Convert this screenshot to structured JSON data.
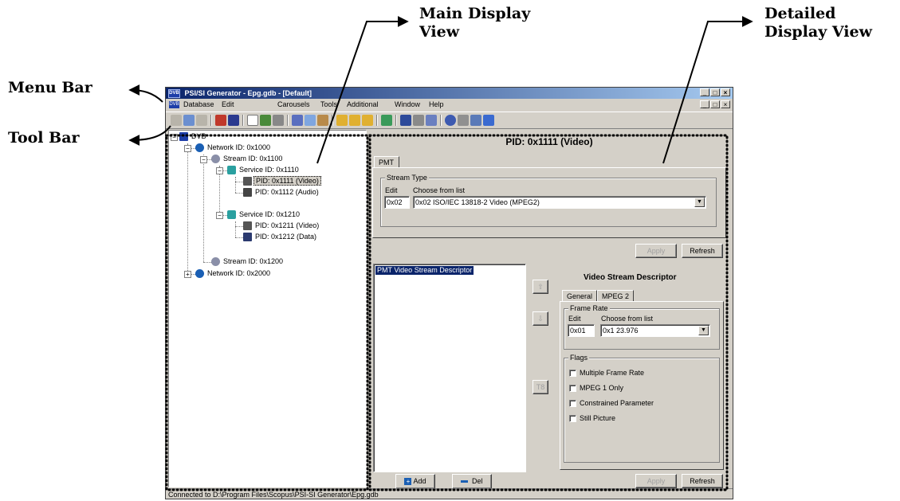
{
  "callouts": {
    "main_display_view": [
      "Main Display",
      "View"
    ],
    "detailed_display_view": [
      "Detailed",
      "Display View"
    ],
    "menu_bar": "Menu Bar",
    "tool_bar": "Tool Bar"
  },
  "window": {
    "app_icon": "DVB",
    "title": "PSI/SI Generator - Epg.gdb - [Default]",
    "buttons": [
      "_",
      "□",
      "×"
    ]
  },
  "menu": {
    "doc_icon": "DVB",
    "items": [
      "Database",
      "Edit",
      "Carousels",
      "Tools",
      "Additional",
      "Window",
      "Help"
    ]
  },
  "tree": {
    "nodes": [
      {
        "label": "DVB",
        "icon": "dvb-icon",
        "selected": false
      },
      {
        "label": "Network ID: 0x1000",
        "icon": "globe-icon",
        "selected": false
      },
      {
        "label": "Stream ID: 0x1100",
        "icon": "satellite-dish-icon",
        "selected": false
      },
      {
        "label": "Service ID: 0x1110",
        "icon": "service-icon",
        "selected": false
      },
      {
        "label": "PID: 0x1111 (Video)",
        "icon": "video-camera-icon",
        "selected": true
      },
      {
        "label": "PID: 0x1112 (Audio)",
        "icon": "speaker-icon",
        "selected": false
      },
      {
        "label": "Service ID: 0x1210",
        "icon": "service-icon",
        "selected": false
      },
      {
        "label": "PID: 0x1211 (Video)",
        "icon": "video-camera-icon",
        "selected": false
      },
      {
        "label": "PID: 0x1212 (Data)",
        "icon": "floppy-disk-icon",
        "selected": false
      },
      {
        "label": "Stream ID: 0x1200",
        "icon": "satellite-dish-icon",
        "selected": false
      },
      {
        "label": "Network ID: 0x2000",
        "icon": "globe-icon",
        "selected": false
      }
    ]
  },
  "detail": {
    "header": "PID: 0x1111 (Video)",
    "tab": "PMT",
    "stream_type": {
      "legend": "Stream Type",
      "edit_label": "Edit",
      "choose_label": "Choose from list",
      "edit_value": "0x02",
      "choose_value": "0x02 ISO/IEC 13818-2 Video (MPEG2)"
    },
    "apply": "Apply",
    "refresh": "Refresh",
    "descriptors": [
      "PMT Video Stream Descriptor"
    ],
    "add": "Add",
    "del": "Del",
    "move_buttons": [
      "⇧",
      "⇩",
      "T8"
    ],
    "descriptor_panel": {
      "title": "Video Stream Descriptor",
      "tabs": [
        "General",
        "MPEG 2"
      ],
      "frame_rate": {
        "legend": "Frame Rate",
        "edit_label": "Edit",
        "choose_label": "Choose from list",
        "edit_value": "0x01",
        "choose_value": "0x1 23.976"
      },
      "flags": {
        "legend": "Flags",
        "items": [
          {
            "label": "Multiple Frame Rate",
            "checked": false
          },
          {
            "label": "MPEG 1 Only",
            "checked": false
          },
          {
            "label": "Constrained Parameter",
            "checked": false
          },
          {
            "label": "Still Picture",
            "checked": false
          }
        ]
      },
      "apply": "Apply",
      "refresh": "Refresh"
    }
  },
  "status_bar": "Connected to D:\\Program Files\\Scopus\\PSI-SI Generator\\Epg.gdb"
}
